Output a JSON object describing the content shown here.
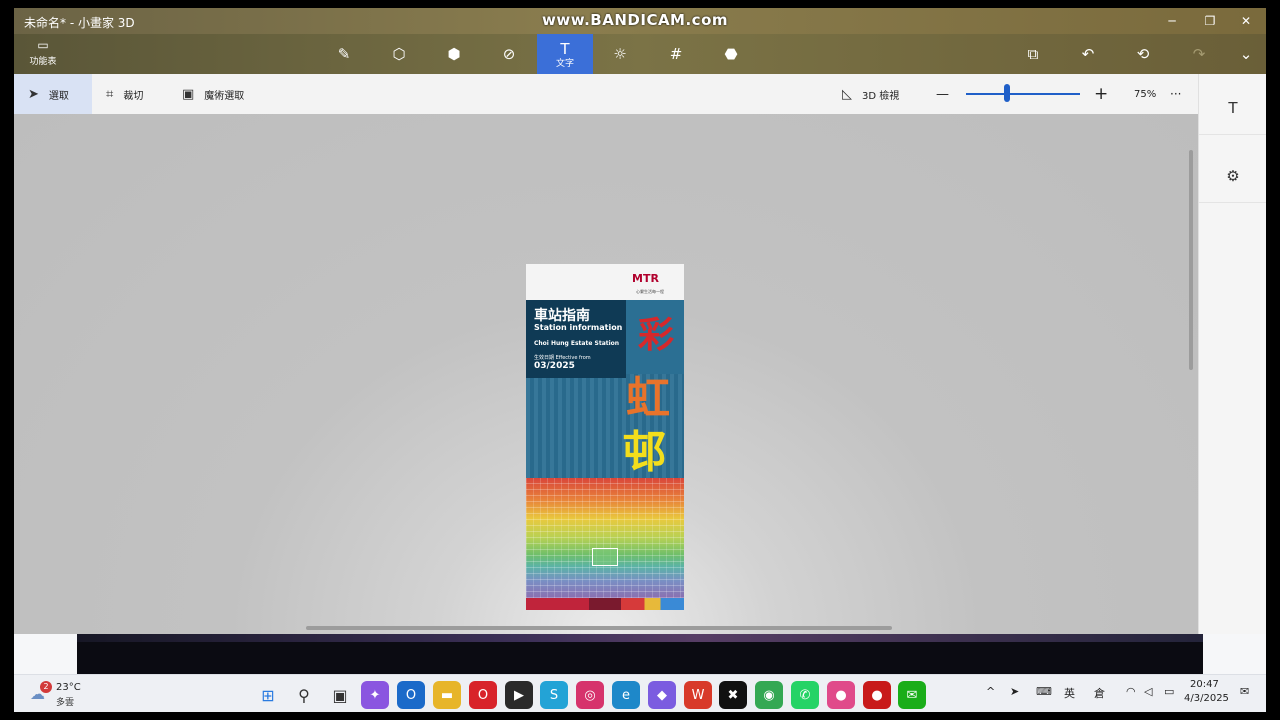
{
  "window": {
    "title": "未命名* - 小畫家 3D",
    "watermark": "www.BANDICAM.com",
    "minimize": "─",
    "maximize": "❐",
    "close": "✕"
  },
  "toolbar": {
    "menu_label": "功能表",
    "tools": [
      {
        "name": "brushes",
        "icon": "brush-icon",
        "glyph": "✎"
      },
      {
        "name": "2d-shapes",
        "icon": "shapes-2d-icon",
        "glyph": "⬡"
      },
      {
        "name": "3d-shapes",
        "icon": "cube-icon",
        "glyph": "⬢"
      },
      {
        "name": "stickers",
        "icon": "sticker-icon",
        "glyph": "⊘"
      },
      {
        "name": "text",
        "icon": "text-icon",
        "glyph": "T",
        "label": "文字",
        "active": true
      },
      {
        "name": "effects",
        "icon": "effects-icon",
        "glyph": "☼"
      },
      {
        "name": "canvas",
        "icon": "canvas-icon",
        "glyph": "#"
      },
      {
        "name": "3d-library",
        "icon": "library-icon",
        "glyph": "⬣"
      }
    ],
    "right": {
      "paste": "⧉",
      "undo": "↶",
      "history": "⟲",
      "redo": "↷",
      "expand": "⌄"
    }
  },
  "subbar": {
    "select_label": "選取",
    "crop_label": "裁切",
    "magic_select_label": "魔術選取",
    "view3d_label": "3D 檢視",
    "zoom_minus": "—",
    "zoom_plus": "+",
    "zoom_value": "75%",
    "more": "···"
  },
  "right_panel": {
    "text_icon": "T",
    "settings_icon": "⚙"
  },
  "poster": {
    "brand": "MTR",
    "slogan": "心繫生活每一程",
    "title_zh": "車站指南",
    "title_en": "Station information",
    "station": "Choi Hung Estate Station",
    "effective": "生效日期 Effective from",
    "date": "03/2025",
    "callig_1": "彩",
    "callig_2": "虹",
    "callig_3": "邨"
  },
  "taskbar": {
    "weather_badge": "2",
    "weather_temp": "23°C",
    "weather_cond": "多雲",
    "apps": [
      {
        "name": "start",
        "glyph": "⊞",
        "color": "#2a7be0"
      },
      {
        "name": "search",
        "glyph": "⚲",
        "color": "#333333"
      },
      {
        "name": "task-view",
        "glyph": "▣",
        "color": "#333333"
      },
      {
        "name": "copilot",
        "glyph": "✦",
        "color": "#8a56e0"
      },
      {
        "name": "outlook",
        "glyph": "O",
        "color": "#1b6ac9"
      },
      {
        "name": "file-explorer",
        "glyph": "▬",
        "color": "#e7b52a"
      },
      {
        "name": "opera",
        "glyph": "O",
        "color": "#d8232a"
      },
      {
        "name": "media-player",
        "glyph": "▶",
        "color": "#2a2a2a"
      },
      {
        "name": "s-app",
        "glyph": "S",
        "color": "#23a3d6"
      },
      {
        "name": "instagram",
        "glyph": "◎",
        "color": "#d6336c"
      },
      {
        "name": "edge",
        "glyph": "e",
        "color": "#1e88c9"
      },
      {
        "name": "photos",
        "glyph": "◆",
        "color": "#7b5ce0"
      },
      {
        "name": "wps",
        "glyph": "W",
        "color": "#d83a2a"
      },
      {
        "name": "capcut",
        "glyph": "✖",
        "color": "#111111"
      },
      {
        "name": "chrome",
        "glyph": "◉",
        "color": "#34a853"
      },
      {
        "name": "whatsapp",
        "glyph": "✆",
        "color": "#25d366"
      },
      {
        "name": "paint3d",
        "glyph": "●",
        "color": "#e04a8a"
      },
      {
        "name": "bandicam",
        "glyph": "●",
        "color": "#c81a1a"
      },
      {
        "name": "wechat",
        "glyph": "✉",
        "color": "#1aad19"
      }
    ],
    "tray": {
      "chevron": "^",
      "location": "➤",
      "keyboard": "⌨",
      "ime_lang": "英",
      "ime_mode": "倉",
      "wifi": "◠",
      "volume": "◁",
      "battery": "▭"
    },
    "time": "20:47",
    "date": "4/3/2025",
    "notification": "✉"
  }
}
